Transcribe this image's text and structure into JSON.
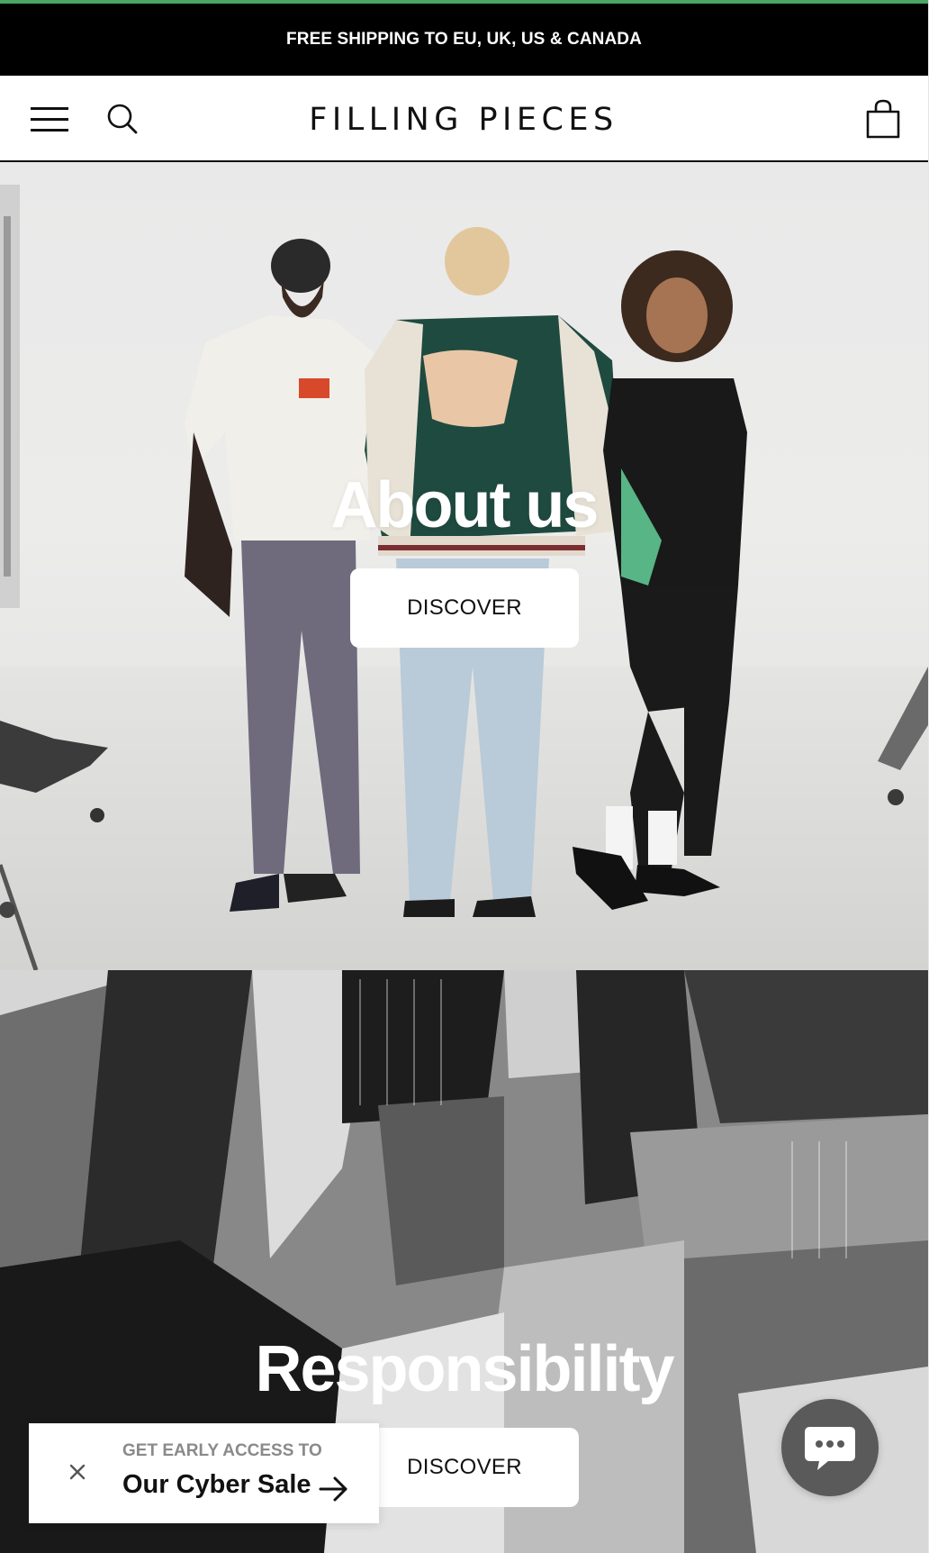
{
  "promo_bar": {
    "text": "FREE SHIPPING TO EU, UK, US & CANADA"
  },
  "header": {
    "menu_icon": "hamburger-menu-icon",
    "search_icon": "search-icon",
    "logo_text": "FILLING PIECES",
    "cart_icon": "shopping-bag-icon"
  },
  "sections": [
    {
      "title": "About us",
      "button_label": "DISCOVER"
    },
    {
      "title": "Responsibility",
      "button_label": "DISCOVER"
    }
  ],
  "popup": {
    "eyebrow": "GET EARLY ACCESS TO",
    "headline": "Our Cyber Sale",
    "close_icon": "close-icon",
    "arrow_icon": "arrow-right-icon"
  },
  "chat": {
    "icon": "chat-bubble-icon"
  },
  "colors": {
    "promo_background": "#000000",
    "accent_line": "#4aa564",
    "chat_button": "#5a5a5a"
  }
}
